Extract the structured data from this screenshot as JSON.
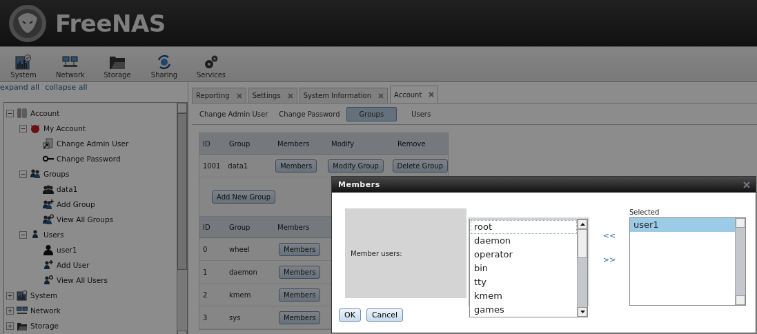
{
  "header": {
    "logo": "FreeNAS"
  },
  "toolbar": [
    {
      "label": "System"
    },
    {
      "label": "Network"
    },
    {
      "label": "Storage"
    },
    {
      "label": "Sharing"
    },
    {
      "label": "Services"
    }
  ],
  "tree_links": [
    "expand all",
    "collapse all"
  ],
  "tree": [
    {
      "label": "Account",
      "kind": "account",
      "expanded": true,
      "children": [
        {
          "label": "My Account",
          "kind": "mascot",
          "expanded": true,
          "children": [
            {
              "label": "Change Admin User",
              "kind": "admin"
            },
            {
              "label": "Change Password",
              "kind": "key"
            }
          ]
        },
        {
          "label": "Groups",
          "kind": "group",
          "expanded": true,
          "children": [
            {
              "label": "data1",
              "kind": "crowd"
            },
            {
              "label": "Add Group",
              "kind": "group-add"
            },
            {
              "label": "View All Groups",
              "kind": "group-search"
            }
          ]
        },
        {
          "label": "Users",
          "kind": "user",
          "expanded": true,
          "children": [
            {
              "label": "user1",
              "kind": "person"
            },
            {
              "label": "Add User",
              "kind": "user-add"
            },
            {
              "label": "View All Users",
              "kind": "user-search"
            }
          ]
        }
      ]
    },
    {
      "label": "System",
      "kind": "system",
      "expanded": false
    },
    {
      "label": "Network",
      "kind": "network",
      "expanded": false
    },
    {
      "label": "Storage",
      "kind": "storage",
      "expanded": false
    }
  ],
  "tabs": [
    {
      "label": "Reporting",
      "selected": false
    },
    {
      "label": "Settings",
      "selected": false
    },
    {
      "label": "System Information",
      "selected": false
    },
    {
      "label": "Account",
      "selected": true
    }
  ],
  "subtabs": [
    {
      "label": "Change Admin User",
      "selected": false
    },
    {
      "label": "Change Password",
      "selected": false
    },
    {
      "label": "Groups",
      "selected": true
    },
    {
      "label": "Users",
      "selected": false
    }
  ],
  "user_groups": {
    "columns": [
      "ID",
      "Group",
      "Members",
      "Modify",
      "Remove"
    ],
    "rows": [
      {
        "id": "1001",
        "group": "data1",
        "members": "Members",
        "modify": "Modify Group",
        "remove": "Delete Group"
      }
    ],
    "add_button": "Add New Group"
  },
  "system_groups": {
    "columns": [
      "ID",
      "Group",
      "Members"
    ],
    "rows": [
      {
        "id": "0",
        "group": "wheel",
        "members": "Members"
      },
      {
        "id": "1",
        "group": "daemon",
        "members": "Members"
      },
      {
        "id": "2",
        "group": "kmem",
        "members": "Members"
      },
      {
        "id": "3",
        "group": "sys",
        "members": "Members"
      }
    ]
  },
  "dialog": {
    "title": "Members",
    "label": "Member users:",
    "available": [
      {
        "label": "root",
        "focused": true
      },
      {
        "label": "daemon",
        "focused": false
      },
      {
        "label": "operator",
        "focused": false
      },
      {
        "label": "bin",
        "focused": false
      },
      {
        "label": "tty",
        "focused": false
      },
      {
        "label": "kmem",
        "focused": false
      },
      {
        "label": "games",
        "focused": false
      }
    ],
    "move_left": "<<",
    "move_right": ">>",
    "selected_title": "Selected",
    "selected": [
      {
        "label": "user1",
        "selected": true
      }
    ],
    "buttons": [
      "OK",
      "Cancel"
    ]
  }
}
